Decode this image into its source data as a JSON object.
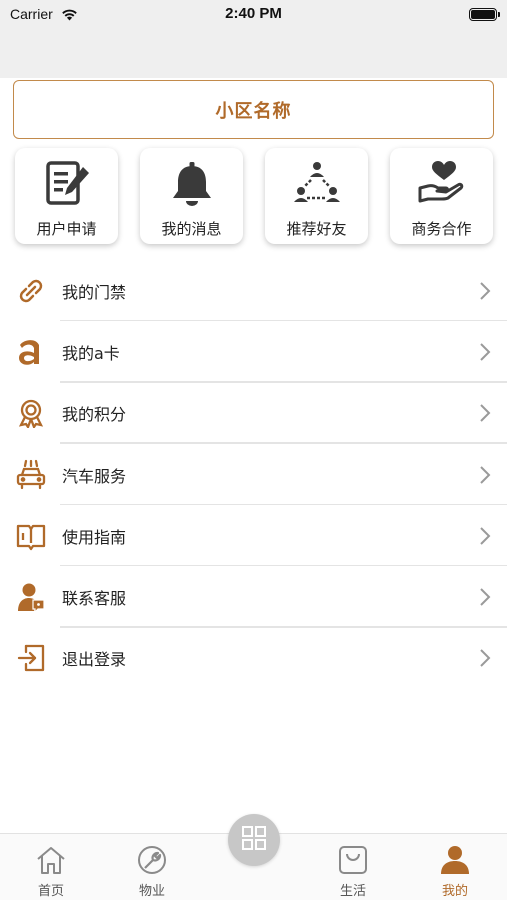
{
  "status_bar": {
    "carrier": "Carrier",
    "time": "2:40 PM"
  },
  "community": {
    "name": "小区名称"
  },
  "quick_actions": [
    {
      "label": "用户申请",
      "icon": "application-form-icon"
    },
    {
      "label": "我的消息",
      "icon": "bell-icon"
    },
    {
      "label": "推荐好友",
      "icon": "network-friends-icon"
    },
    {
      "label": "商务合作",
      "icon": "hand-heart-icon"
    }
  ],
  "menu": [
    {
      "label": "我的门禁",
      "icon": "link-icon"
    },
    {
      "label": "我的a卡",
      "icon": "a-card-icon"
    },
    {
      "label": "我的积分",
      "icon": "medal-icon"
    },
    {
      "label": "汽车服务",
      "icon": "car-icon"
    },
    {
      "label": "使用指南",
      "icon": "book-icon"
    },
    {
      "label": "联系客服",
      "icon": "customer-service-icon"
    },
    {
      "label": "退出登录",
      "icon": "logout-icon"
    }
  ],
  "tabs": [
    {
      "label": "首页",
      "icon": "home-icon"
    },
    {
      "label": "物业",
      "icon": "wrench-icon"
    },
    {
      "label": "生活",
      "icon": "shopping-bag-icon"
    },
    {
      "label": "我的",
      "icon": "person-icon",
      "active": true
    }
  ],
  "colors": {
    "accent": "#b06a2a",
    "border": "#c28a4b",
    "icon_gray": "#3a3a3a"
  }
}
